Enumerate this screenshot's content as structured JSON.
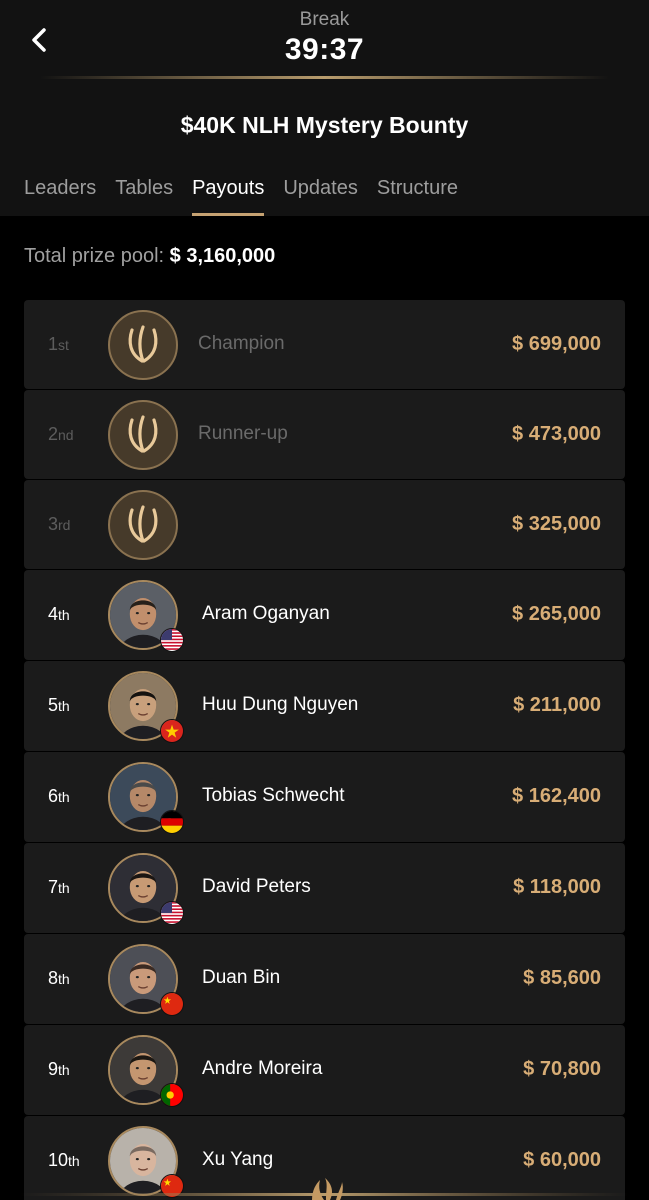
{
  "header": {
    "status_label": "Break",
    "timer": "39:37",
    "title": "$40K NLH Mystery Bounty"
  },
  "tabs": [
    {
      "label": "Leaders",
      "active": false
    },
    {
      "label": "Tables",
      "active": false
    },
    {
      "label": "Payouts",
      "active": true
    },
    {
      "label": "Updates",
      "active": false
    },
    {
      "label": "Structure",
      "active": false
    }
  ],
  "prize_pool": {
    "label": "Total prize pool:",
    "amount": "$ 3,160,000"
  },
  "payouts": [
    {
      "rank": "1",
      "suffix": "st",
      "name": "Champion",
      "prize": "$ 699,000",
      "placeholder": true,
      "icon": "triton-logo-icon"
    },
    {
      "rank": "2",
      "suffix": "nd",
      "name": "Runner-up",
      "prize": "$ 473,000",
      "placeholder": true,
      "icon": "triton-logo-icon"
    },
    {
      "rank": "3",
      "suffix": "rd",
      "name": "",
      "prize": "$ 325,000",
      "placeholder": true,
      "icon": "triton-logo-icon"
    },
    {
      "rank": "4",
      "suffix": "th",
      "name": "Aram Oganyan",
      "prize": "$ 265,000",
      "flag": "us-flag-icon"
    },
    {
      "rank": "5",
      "suffix": "th",
      "name": "Huu Dung Nguyen",
      "prize": "$ 211,000",
      "flag": "vietnam-flag-icon"
    },
    {
      "rank": "6",
      "suffix": "th",
      "name": "Tobias Schwecht",
      "prize": "$ 162,400",
      "flag": "germany-flag-icon"
    },
    {
      "rank": "7",
      "suffix": "th",
      "name": "David Peters",
      "prize": "$ 118,000",
      "flag": "us-flag-icon"
    },
    {
      "rank": "8",
      "suffix": "th",
      "name": "Duan Bin",
      "prize": "$ 85,600",
      "flag": "china-flag-icon"
    },
    {
      "rank": "9",
      "suffix": "th",
      "name": "Andre Moreira",
      "prize": "$ 70,800",
      "flag": "portugal-flag-icon"
    },
    {
      "rank": "10",
      "suffix": "th",
      "name": "Xu Yang",
      "prize": "$ 60,000",
      "flag": "china-flag-icon"
    }
  ],
  "colors": {
    "accent_gold": "#c5a272",
    "prize_gold": "#d8ad76",
    "background": "#000000",
    "card": "#1b1b1b"
  }
}
